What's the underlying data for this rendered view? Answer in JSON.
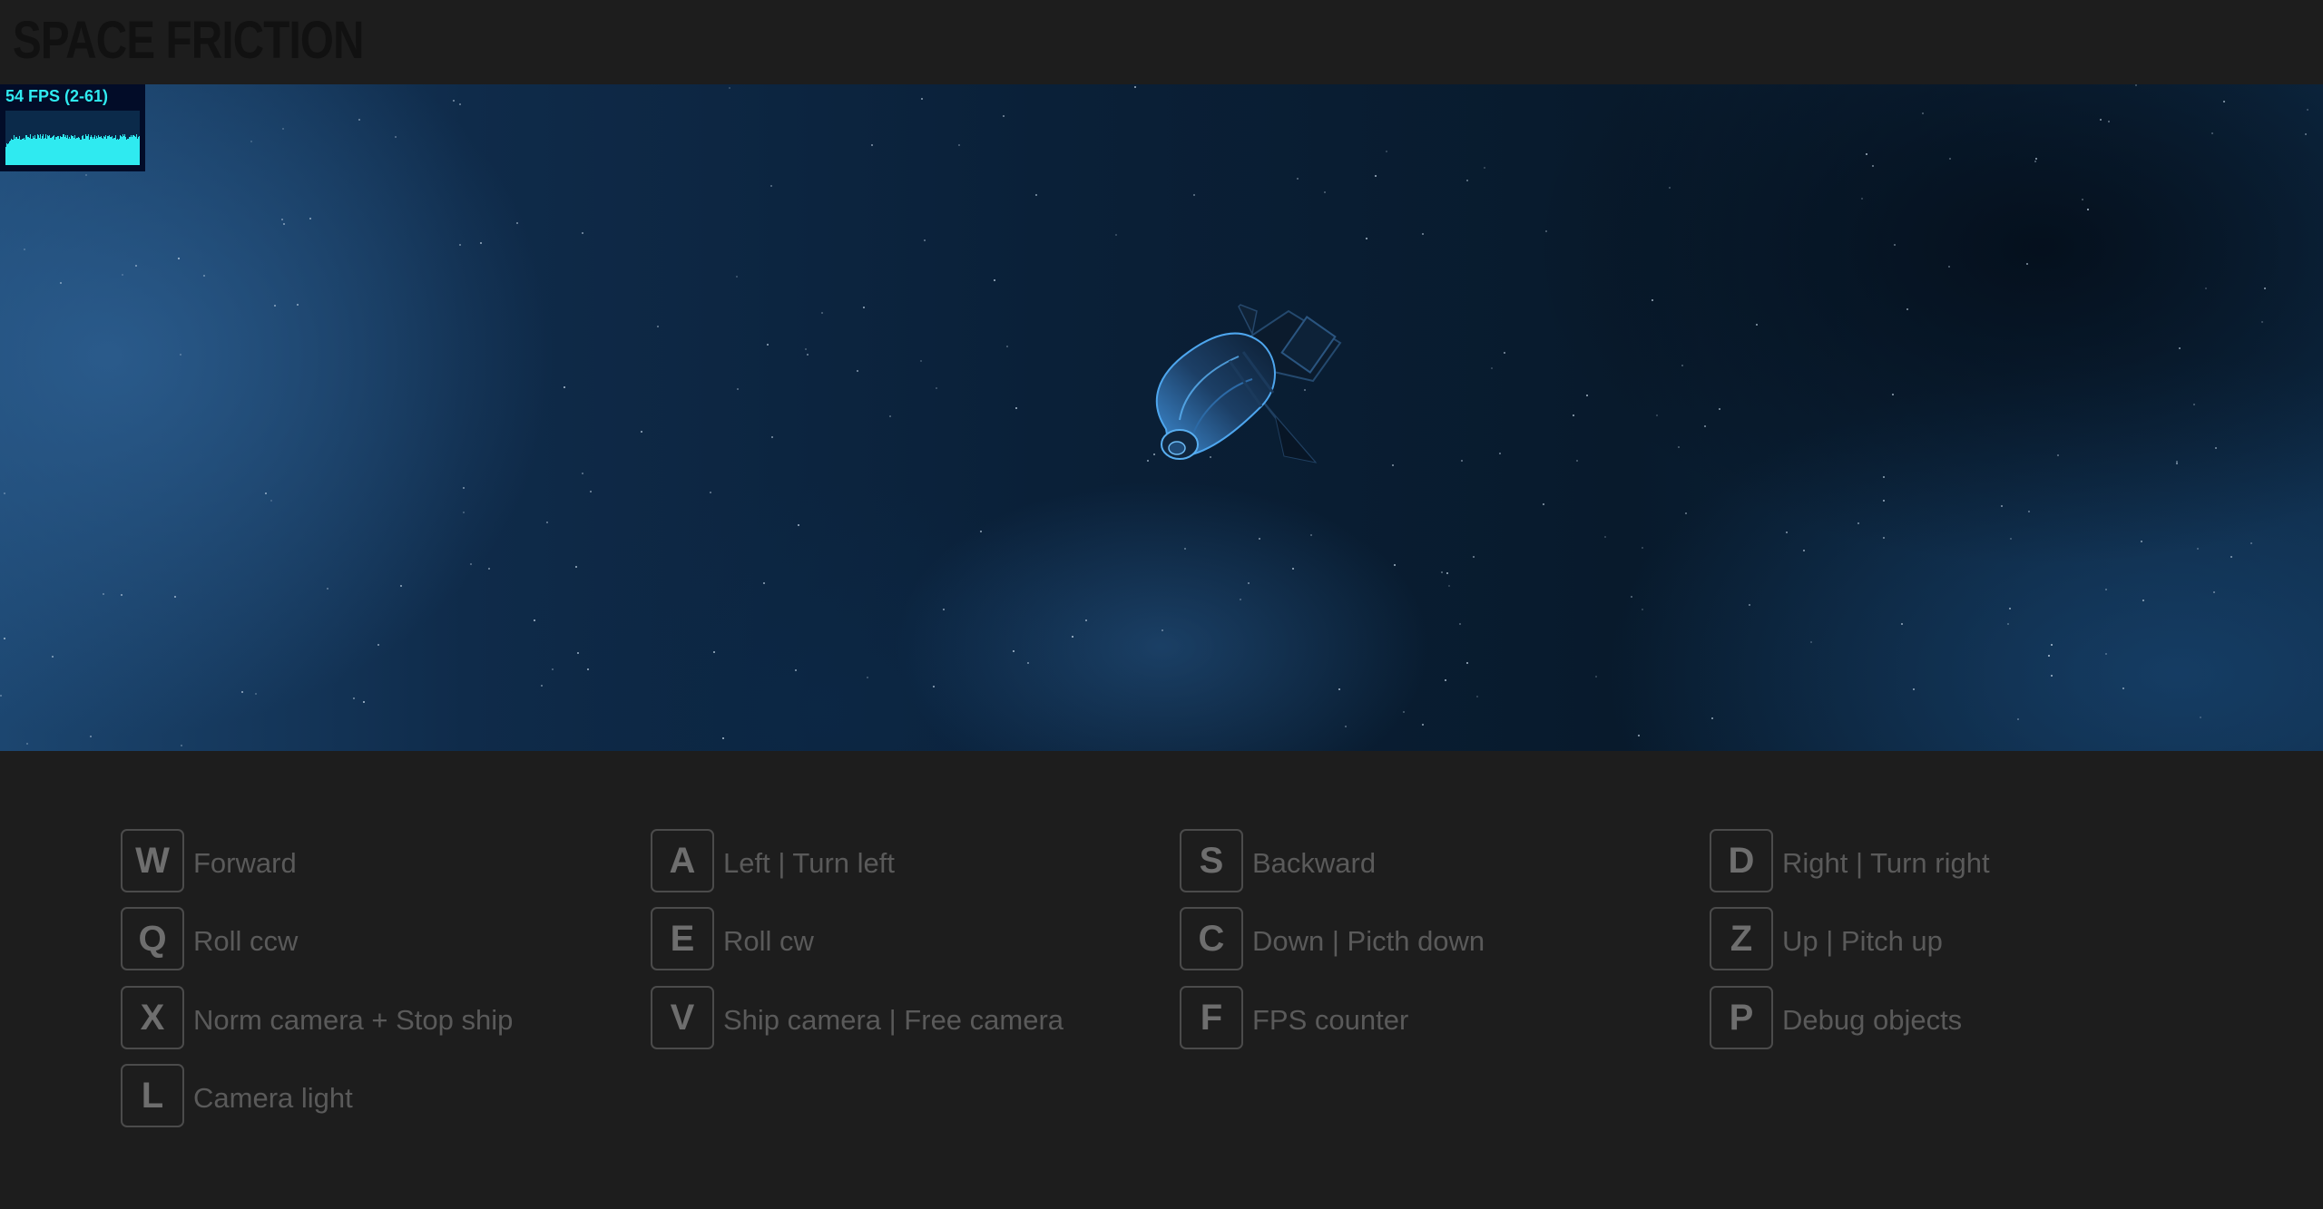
{
  "app": {
    "title": "SPACE FRICTION"
  },
  "fps": {
    "label": "54 FPS (2-61)",
    "color": "#2feaf0",
    "background": "#020c28"
  },
  "controls": [
    {
      "key": "W",
      "label": "Forward"
    },
    {
      "key": "A",
      "label": "Left | Turn left"
    },
    {
      "key": "S",
      "label": "Backward"
    },
    {
      "key": "D",
      "label": "Right | Turn right"
    },
    {
      "key": "Q",
      "label": "Roll ccw"
    },
    {
      "key": "E",
      "label": "Roll cw"
    },
    {
      "key": "C",
      "label": "Down | Picth down"
    },
    {
      "key": "Z",
      "label": "Up | Pitch up"
    },
    {
      "key": "X",
      "label": "Norm camera + Stop ship"
    },
    {
      "key": "V",
      "label": "Ship camera | Free camera"
    },
    {
      "key": "F",
      "label": "FPS counter"
    },
    {
      "key": "P",
      "label": "Debug objects"
    },
    {
      "key": "L",
      "label": "Camera light"
    }
  ]
}
